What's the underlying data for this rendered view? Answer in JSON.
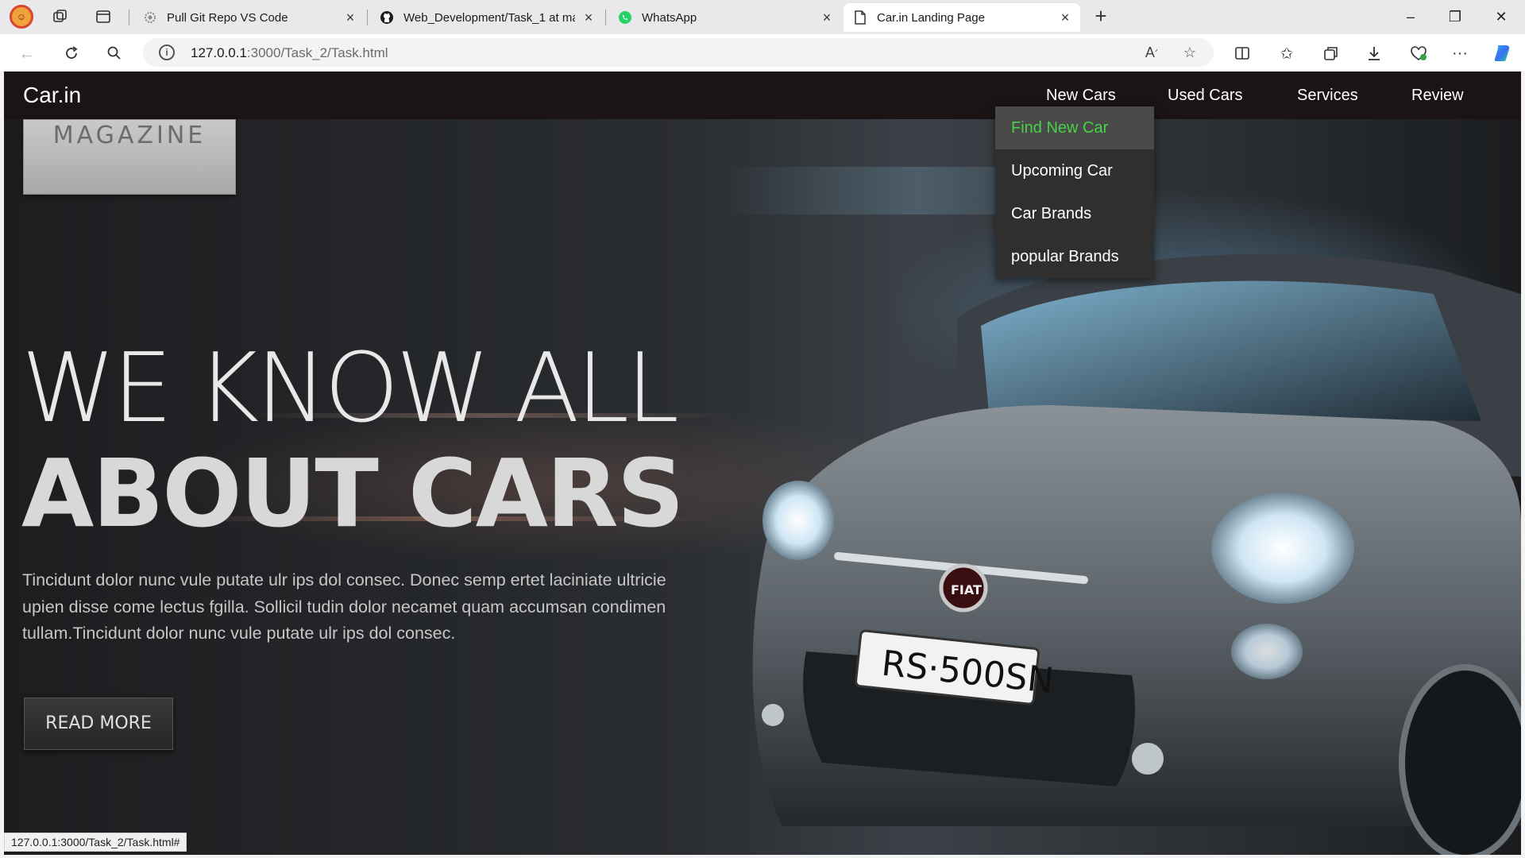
{
  "browser": {
    "tabs": [
      {
        "title": "Pull Git Repo VS Code",
        "icon": "gear-icon"
      },
      {
        "title": "Web_Development/Task_1 at ma",
        "icon": "github-icon"
      },
      {
        "title": "WhatsApp",
        "icon": "whatsapp-icon"
      },
      {
        "title": "Car.in Landing Page",
        "icon": "page-icon",
        "active": true
      }
    ],
    "url_host": "127.0.0.1",
    "url_rest": ":3000/Task_2/Task.html",
    "status_url": "127.0.0.1:3000/Task_2/Task.html#"
  },
  "site": {
    "brand": "Car.in",
    "nav": [
      "New Cars",
      "Used Cars",
      "Services",
      "Review"
    ],
    "dropdown": [
      "Find New Car",
      "Upcoming Car",
      "Car Brands",
      "popular Brands"
    ],
    "dropdown_highlight_color": "#46d146",
    "magazine_label": "MAGAZINE",
    "hero_line1": "WE KNOW ALL",
    "hero_line2": "ABOUT CARS",
    "paragraph": "Tincidunt dolor nunc vule putate ulr ips dol consec. Donec semp ertet laciniate ultricie upien disse come lectus fgilla. Sollicil tudin dolor necamet quam accumsan condimen tullam.Tincidunt dolor nunc vule putate ulr ips dol consec.",
    "read_more": "READ MORE",
    "plate": "RS·500SN",
    "badge": "FIAT"
  }
}
